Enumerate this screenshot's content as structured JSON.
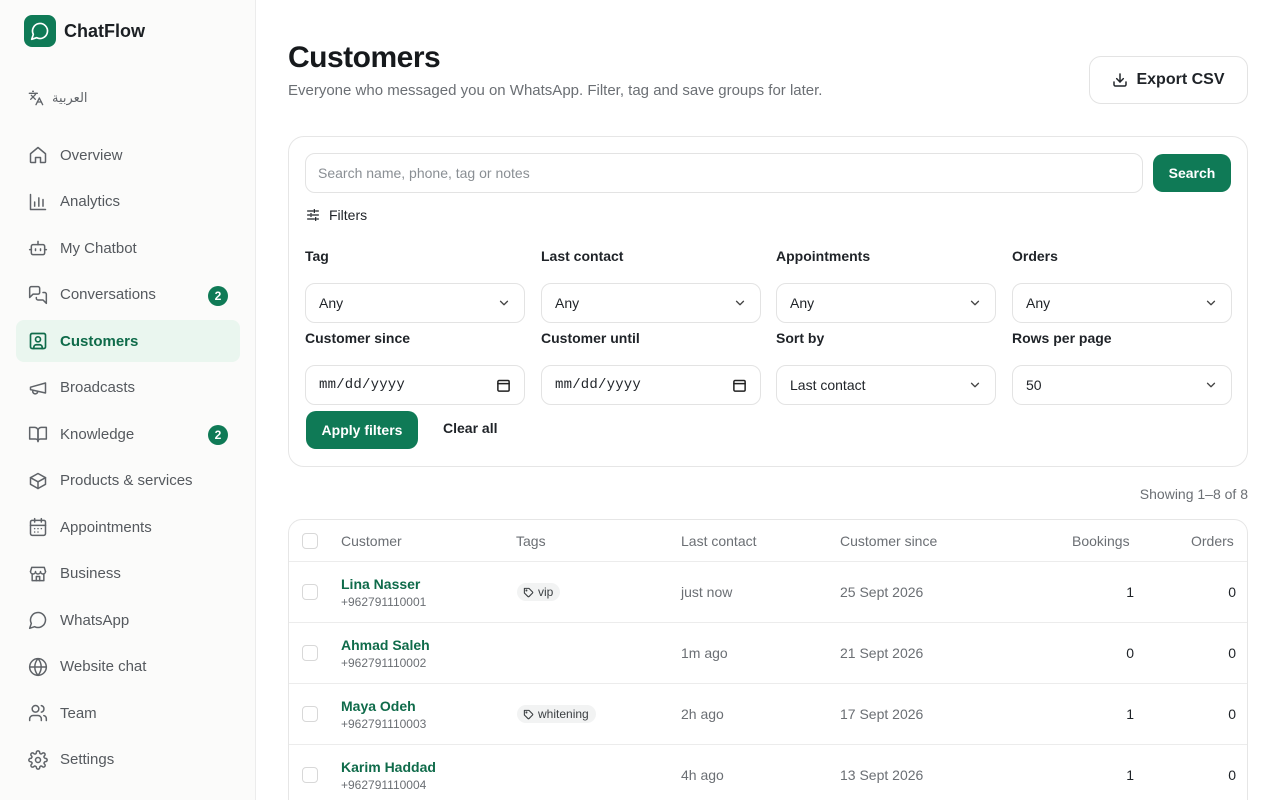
{
  "app": {
    "name": "ChatFlow"
  },
  "sidebar": {
    "language": "العربية",
    "items": [
      {
        "label": "Overview",
        "icon": "home-icon"
      },
      {
        "label": "Analytics",
        "icon": "bar-chart-icon"
      },
      {
        "label": "My Chatbot",
        "icon": "bot-icon"
      },
      {
        "label": "Conversations",
        "icon": "chat-bubbles-icon",
        "badge": "2"
      },
      {
        "label": "Customers",
        "icon": "contact-card-icon",
        "active": true
      },
      {
        "label": "Broadcasts",
        "icon": "megaphone-icon"
      },
      {
        "label": "Knowledge",
        "icon": "book-icon",
        "badge": "2"
      },
      {
        "label": "Products & services",
        "icon": "box-icon"
      },
      {
        "label": "Appointments",
        "icon": "calendar-icon"
      },
      {
        "label": "Business",
        "icon": "store-icon"
      },
      {
        "label": "WhatsApp",
        "icon": "message-circle-icon"
      },
      {
        "label": "Website chat",
        "icon": "globe-icon"
      },
      {
        "label": "Team",
        "icon": "users-icon"
      },
      {
        "label": "Settings",
        "icon": "gear-icon"
      }
    ]
  },
  "header": {
    "title": "Customers",
    "subtitle": "Everyone who messaged you on WhatsApp. Filter, tag and save groups for later.",
    "export_label": "Export CSV"
  },
  "search": {
    "placeholder": "Search name, phone, tag or notes",
    "button_label": "Search"
  },
  "filters": {
    "heading": "Filters",
    "tag": {
      "label": "Tag",
      "value": "Any"
    },
    "last_contact": {
      "label": "Last contact",
      "value": "Any"
    },
    "appointments": {
      "label": "Appointments",
      "value": "Any"
    },
    "orders": {
      "label": "Orders",
      "value": "Any"
    },
    "customer_since": {
      "label": "Customer since",
      "value": "mm/dd/yyyy"
    },
    "customer_until": {
      "label": "Customer until",
      "value": "mm/dd/yyyy"
    },
    "sort_by": {
      "label": "Sort by",
      "value": "Last contact"
    },
    "rows_per_page": {
      "label": "Rows per page",
      "value": "50"
    },
    "apply_label": "Apply filters",
    "clear_label": "Clear all"
  },
  "results": {
    "showing": "Showing 1–8 of 8"
  },
  "table": {
    "columns": {
      "customer": "Customer",
      "tags": "Tags",
      "last_contact": "Last contact",
      "customer_since": "Customer since",
      "bookings": "Bookings",
      "orders": "Orders"
    },
    "rows": [
      {
        "name": "Lina Nasser",
        "phone": "+962791110001",
        "tag": "vip",
        "last_contact": "just now",
        "since": "25 Sept 2026",
        "bookings": "1",
        "orders": "0"
      },
      {
        "name": "Ahmad Saleh",
        "phone": "+962791110002",
        "tag": "",
        "last_contact": "1m ago",
        "since": "21 Sept 2026",
        "bookings": "0",
        "orders": "0"
      },
      {
        "name": "Maya Odeh",
        "phone": "+962791110003",
        "tag": "whitening",
        "last_contact": "2h ago",
        "since": "17 Sept 2026",
        "bookings": "1",
        "orders": "0"
      },
      {
        "name": "Karim Haddad",
        "phone": "+962791110004",
        "tag": "",
        "last_contact": "4h ago",
        "since": "13 Sept 2026",
        "bookings": "1",
        "orders": "0"
      }
    ]
  },
  "colors": {
    "brand": "#0f7a56",
    "active_bg": "#eaf6ef",
    "link": "#0f6b4a"
  }
}
